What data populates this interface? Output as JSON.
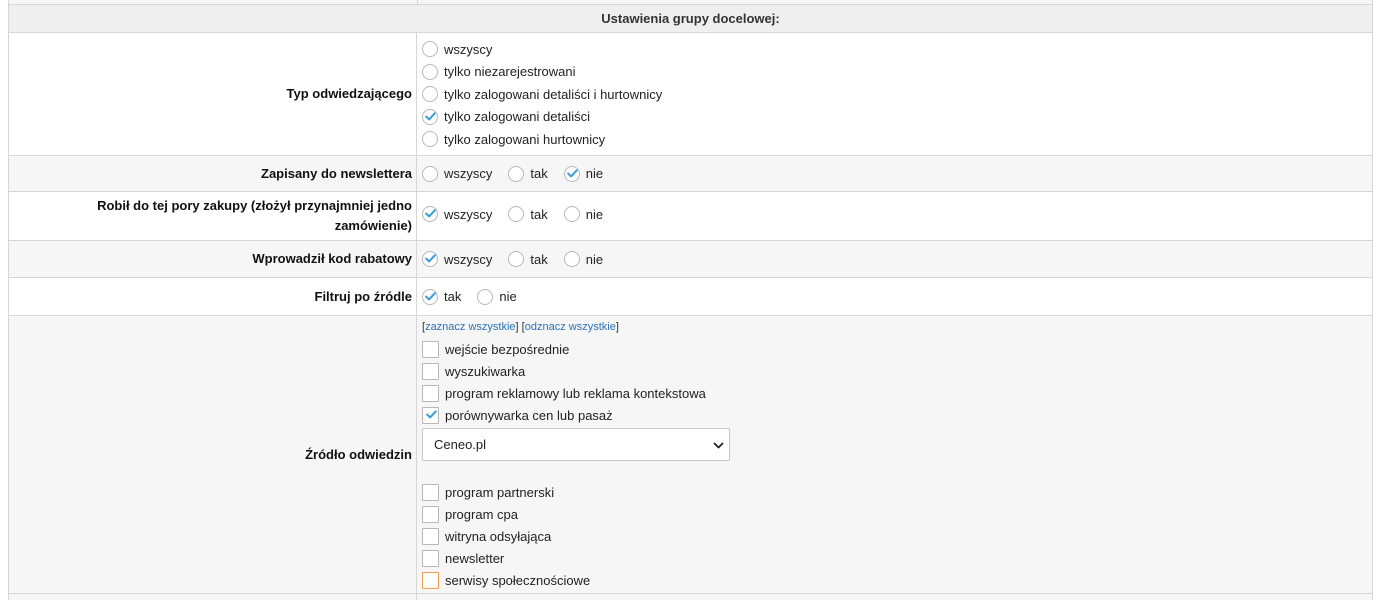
{
  "section_title": "Ustawienia grupy docelowej:",
  "visitor_type": {
    "label": "Typ odwiedzającego",
    "options": [
      {
        "text": "wszyscy",
        "checked": false
      },
      {
        "text": "tylko niezarejestrowani",
        "checked": false
      },
      {
        "text": "tylko zalogowani detaliści i hurtownicy",
        "checked": false
      },
      {
        "text": "tylko zalogowani detaliści",
        "checked": true
      },
      {
        "text": "tylko zalogowani hurtownicy",
        "checked": false
      }
    ]
  },
  "newsletter": {
    "label": "Zapisany do newslettera",
    "options": [
      {
        "text": "wszyscy",
        "checked": false
      },
      {
        "text": "tak",
        "checked": false
      },
      {
        "text": "nie",
        "checked": true
      }
    ]
  },
  "purchases": {
    "label": "Robił do tej pory zakupy (złożył przynajmniej jedno zamówienie)",
    "options": [
      {
        "text": "wszyscy",
        "checked": true
      },
      {
        "text": "tak",
        "checked": false
      },
      {
        "text": "nie",
        "checked": false
      }
    ]
  },
  "discount_code": {
    "label": "Wprowadził kod rabatowy",
    "options": [
      {
        "text": "wszyscy",
        "checked": true
      },
      {
        "text": "tak",
        "checked": false
      },
      {
        "text": "nie",
        "checked": false
      }
    ]
  },
  "source_filter": {
    "label": "Filtruj po źródle",
    "options": [
      {
        "text": "tak",
        "checked": true
      },
      {
        "text": "nie",
        "checked": false
      }
    ]
  },
  "visit_source": {
    "label": "Źródło odwiedzin",
    "select_all": "zaznacz wszystkie",
    "deselect_all": "odznacz wszystkie",
    "sources_before_select": [
      {
        "text": "wejście bezpośrednie",
        "checked": false
      },
      {
        "text": "wyszukiwarka",
        "checked": false
      },
      {
        "text": "program reklamowy lub reklama kontekstowa",
        "checked": false
      },
      {
        "text": "porównywarka cen lub pasaż",
        "checked": true
      }
    ],
    "comparison_site_select": "Ceneo.pl",
    "sources_after_select": [
      {
        "text": "program partnerski",
        "checked": false
      },
      {
        "text": "program cpa",
        "checked": false
      },
      {
        "text": "witryna odsyłająca",
        "checked": false
      },
      {
        "text": "newsletter",
        "checked": false
      },
      {
        "text": "serwisy społecznościowe",
        "checked": false,
        "focused": true
      }
    ]
  },
  "colors": {
    "check_accent": "#3a9bdc",
    "focus_outline": "#f0a04b",
    "link": "#2a72b8"
  }
}
